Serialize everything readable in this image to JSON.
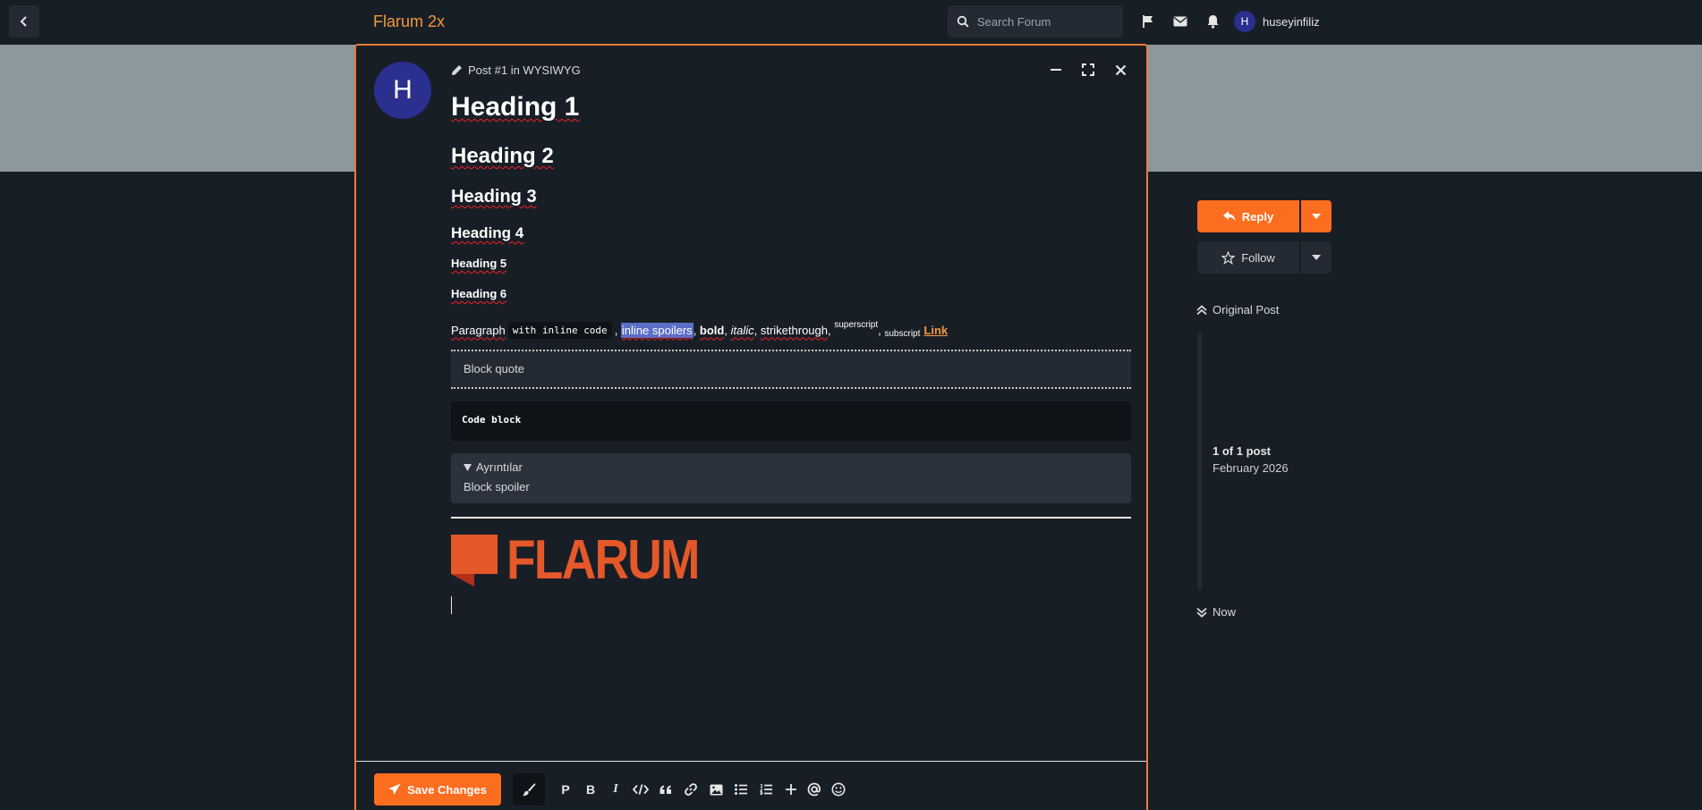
{
  "header": {
    "brand": "Flarum 2x",
    "search_placeholder": "Search Forum",
    "username": "huseyinfiliz",
    "avatar_letter": "H",
    "icons": [
      "chevron-left-icon",
      "search-icon",
      "flag-icon",
      "envelope-icon",
      "bell-icon"
    ]
  },
  "composer": {
    "avatar_letter": "H",
    "title": "Post #1 in WYSIWYG",
    "headings": [
      "Heading 1",
      "Heading 2",
      "Heading 3",
      "Heading 4",
      "Heading 5",
      "Heading 6"
    ],
    "paragraph": {
      "text": "Paragraph",
      "inline_code": "with inline code",
      "inline_spoiler": "inline spoilers",
      "bold": "bold",
      "italic": "italic",
      "strike": "strikethrough",
      "superscript": "superscript",
      "subscript": "subscript",
      "link": "Link"
    },
    "blockquote": "Block quote",
    "code_block": "Code block",
    "details": {
      "summary": "Ayrıntılar",
      "body": "Block spoiler"
    },
    "image_logo_text": "FLARUM",
    "footer": {
      "save_label": "Save Changes",
      "toolbar_icons": [
        "paragraph-icon",
        "bold-icon",
        "italic-icon",
        "code-icon",
        "quote-icon",
        "link-icon",
        "image-icon",
        "bullet-list-icon",
        "numbered-list-icon",
        "plus-icon",
        "mention-icon",
        "emoji-icon"
      ]
    }
  },
  "sidebar": {
    "reply_label": "Reply",
    "follow_label": "Follow",
    "original_post": "Original Post",
    "position": "1 of 1 post",
    "date": "February 2026",
    "now": "Now"
  },
  "colors": {
    "accent": "#fb6d1f",
    "brand": "#f5983b",
    "background": "#181e26",
    "hero": "#8c979e",
    "avatar": "#2b2f8f"
  }
}
